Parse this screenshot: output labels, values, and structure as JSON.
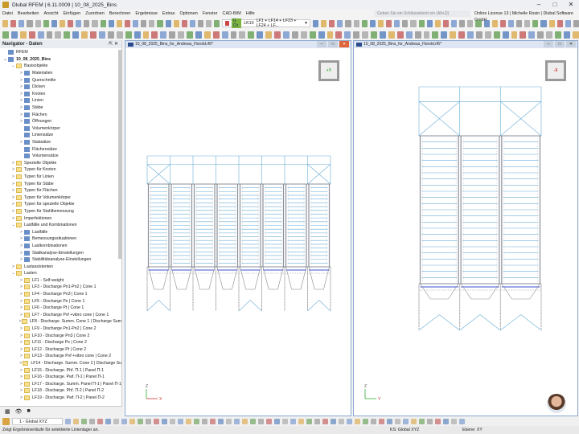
{
  "window": {
    "title": "Dlubal RFEM | 6.11.0009 | 10_08_2025_Bins"
  },
  "menu": [
    "Datei",
    "Bearbeiten",
    "Ansicht",
    "Einfügen",
    "Zuordnen",
    "Berechnen",
    "Ergebnisse",
    "Extras",
    "Optionen",
    "Fenster",
    "CAD-BIM",
    "Hilfe"
  ],
  "search": {
    "placeholder": "Geben Sie ein Schlüsselwort ein (Alt+Q)"
  },
  "license": "Online License 13 | Michelle Rosin | Dlubal Software GmbH",
  "loadcase": {
    "tag": "G Ch",
    "id": "LK10",
    "value": "LF1 + LF14 + LF23 + LF24 + LF..."
  },
  "navigator": {
    "title": "Navigator - Daten",
    "items": [
      {
        "label": "RFEM",
        "level": 0,
        "arrow": "",
        "icon": "obj"
      },
      {
        "label": "10_08_2025_Bins",
        "level": 0,
        "arrow": "v",
        "icon": "obj"
      },
      {
        "label": "Basisobjekte",
        "level": 1,
        "arrow": "v",
        "icon": "fold"
      },
      {
        "label": "Materialien",
        "level": 2,
        "arrow": ">",
        "icon": "obj"
      },
      {
        "label": "Querschnitte",
        "level": 2,
        "arrow": ">",
        "icon": "obj"
      },
      {
        "label": "Dicken",
        "level": 2,
        "arrow": ">",
        "icon": "obj"
      },
      {
        "label": "Knoten",
        "level": 2,
        "arrow": ">",
        "icon": "obj"
      },
      {
        "label": "Linien",
        "level": 2,
        "arrow": ">",
        "icon": "obj"
      },
      {
        "label": "Stäbe",
        "level": 2,
        "arrow": ">",
        "icon": "obj"
      },
      {
        "label": "Flächen",
        "level": 2,
        "arrow": ">",
        "icon": "obj"
      },
      {
        "label": "Öffnungen",
        "level": 2,
        "arrow": ">",
        "icon": "obj"
      },
      {
        "label": "Volumenkörper",
        "level": 2,
        "arrow": "",
        "icon": "obj"
      },
      {
        "label": "Liniensätze",
        "level": 2,
        "arrow": "",
        "icon": "obj"
      },
      {
        "label": "Stabsätze",
        "level": 2,
        "arrow": ">",
        "icon": "obj"
      },
      {
        "label": "Flächensätze",
        "level": 2,
        "arrow": "",
        "icon": "obj"
      },
      {
        "label": "Volumensätze",
        "level": 2,
        "arrow": "",
        "icon": "obj"
      },
      {
        "label": "Spezielle Objekte",
        "level": 1,
        "arrow": ">",
        "icon": "fold"
      },
      {
        "label": "Typen für Knoten",
        "level": 1,
        "arrow": ">",
        "icon": "fold"
      },
      {
        "label": "Typen für Linien",
        "level": 1,
        "arrow": ">",
        "icon": "fold"
      },
      {
        "label": "Typen für Stäbe",
        "level": 1,
        "arrow": ">",
        "icon": "fold"
      },
      {
        "label": "Typen für Flächen",
        "level": 1,
        "arrow": ">",
        "icon": "fold"
      },
      {
        "label": "Typen für Volumenkörper",
        "level": 1,
        "arrow": ">",
        "icon": "fold"
      },
      {
        "label": "Typen für spezielle Objekte",
        "level": 1,
        "arrow": ">",
        "icon": "fold"
      },
      {
        "label": "Typen für Stahlbemessung",
        "level": 1,
        "arrow": ">",
        "icon": "fold"
      },
      {
        "label": "Imperfektionen",
        "level": 1,
        "arrow": ">",
        "icon": "fold"
      },
      {
        "label": "Lastfälle und Kombinationen",
        "level": 1,
        "arrow": "v",
        "icon": "fold"
      },
      {
        "label": "Lastfälle",
        "level": 2,
        "arrow": ">",
        "icon": "obj"
      },
      {
        "label": "Bemessungssituationen",
        "level": 2,
        "arrow": ">",
        "icon": "obj"
      },
      {
        "label": "Lastkombinationen",
        "level": 2,
        "arrow": ">",
        "icon": "obj"
      },
      {
        "label": "Statikanalyse-Einstellungen",
        "level": 2,
        "arrow": ">",
        "icon": "obj"
      },
      {
        "label": "Stabilitätsanalyse-Einstellungen",
        "level": 2,
        "arrow": ">",
        "icon": "obj"
      },
      {
        "label": "Lastassistenten",
        "level": 1,
        "arrow": ">",
        "icon": "fold"
      },
      {
        "label": "Lasten",
        "level": 1,
        "arrow": "v",
        "icon": "fold"
      },
      {
        "label": "LF1 - Self-weight",
        "level": 2,
        "arrow": ">",
        "icon": "fold"
      },
      {
        "label": "LF3 - Discharge Pn1-Pn2 | Cone 1",
        "level": 2,
        "arrow": ">",
        "icon": "fold"
      },
      {
        "label": "LF4 - Discharge Pn3 | Cone 1",
        "level": 2,
        "arrow": ">",
        "icon": "fold"
      },
      {
        "label": "LF5 - Discharge Ps | Cone 1",
        "level": 2,
        "arrow": ">",
        "icon": "fold"
      },
      {
        "label": "LF6 - Discharge Pt | Cone 1",
        "level": 2,
        "arrow": ">",
        "icon": "fold"
      },
      {
        "label": "LF7 - Discharge Pvf +vibro cone | Cone 1",
        "level": 2,
        "arrow": ">",
        "icon": "fold"
      },
      {
        "label": "LF8 - Discharge. Summ. Cone 1 | Discharge Sum",
        "level": 2,
        "arrow": ">",
        "icon": "fold"
      },
      {
        "label": "LF9 - Discharge Pn1-Pn2 | Cone 2",
        "level": 2,
        "arrow": ">",
        "icon": "fold"
      },
      {
        "label": "LF10 - Discharge Pn3 | Cone 2",
        "level": 2,
        "arrow": ">",
        "icon": "fold"
      },
      {
        "label": "LF11 - Discharge Ps | Cone 2",
        "level": 2,
        "arrow": ">",
        "icon": "fold"
      },
      {
        "label": "LF12 - Discharge Pt | Cone 2",
        "level": 2,
        "arrow": ">",
        "icon": "fold"
      },
      {
        "label": "LF13 - Discharge Pvf +vibro cone | Cone 2",
        "level": 2,
        "arrow": ">",
        "icon": "fold"
      },
      {
        "label": "LF14 - Discharge. Summ. Cone 2 | Discharge Su",
        "level": 2,
        "arrow": ">",
        "icon": "fold"
      },
      {
        "label": "LF15 - Discharge. Phf. Π-1 | Panel Π-1",
        "level": 2,
        "arrow": ">",
        "icon": "fold"
      },
      {
        "label": "LF16 - Discharge. Pwf. Π-1 | Panel Π-1",
        "level": 2,
        "arrow": ">",
        "icon": "fold"
      },
      {
        "label": "LF17 - Discharge. Summ. Panel Π-1 | Panel Π-1",
        "level": 2,
        "arrow": ">",
        "icon": "fold"
      },
      {
        "label": "LF18 - Discharge. Phf. Π-2 | Panel Π-2",
        "level": 2,
        "arrow": ">",
        "icon": "fold"
      },
      {
        "label": "LF19 - Discharge. Pwf. Π-2 | Panel Π-2",
        "level": 2,
        "arrow": ">",
        "icon": "fold"
      }
    ]
  },
  "viewports": [
    {
      "title": "10_08_2025_Bins_for_Andreas_Horold.rf6*",
      "cube": "+Y",
      "axes": [
        "Z",
        "X"
      ]
    },
    {
      "title": "10_08_2025_Bins_for_Andreas_Horold.rf6*",
      "cube": "-X",
      "axes": [
        "Z",
        "Y"
      ]
    }
  ],
  "bottom": {
    "coord_system": "1 - Global XYZ",
    "ks": "KS: Global XYZ",
    "ebene": "Ebene: XY"
  },
  "status": "Zeigt Ergebnisverläufe für selektierte Linienlager an."
}
